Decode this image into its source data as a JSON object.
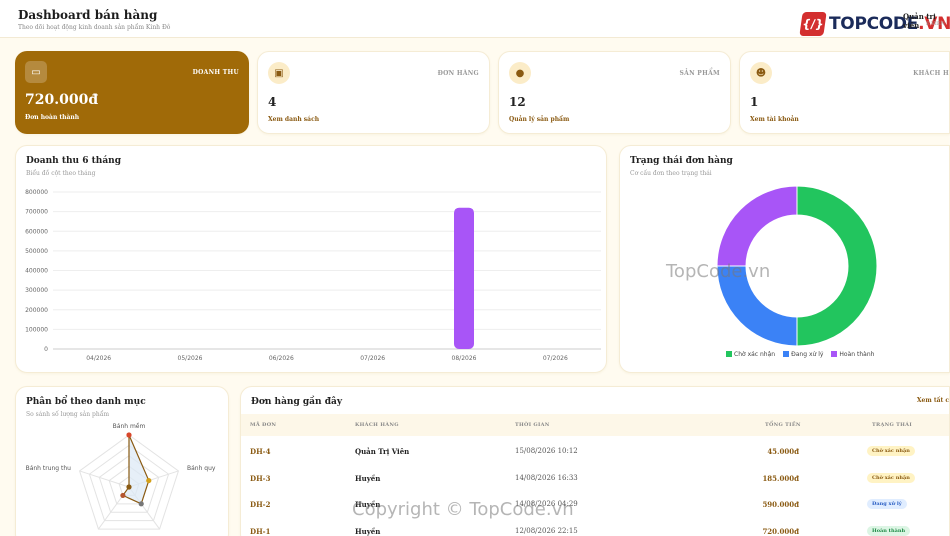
{
  "header": {
    "title": "Dashboard bán hàng",
    "subtitle": "Theo dõi hoạt động kinh doanh sản phẩm Kinh Đô",
    "user_name": "Quản trị viên",
    "user_role": "E VIÊN"
  },
  "logo": {
    "mark": "{/}",
    "text_main": "TOPCODE",
    "text_dot": ".VN"
  },
  "stats": [
    {
      "label": "DOANH THU",
      "value": "720.000đ",
      "link": "Đơn hoàn thành",
      "icon": "wallet-icon",
      "glyph": "▭"
    },
    {
      "label": "ĐƠN HÀNG",
      "value": "4",
      "link": "Xem danh sách",
      "icon": "box-icon",
      "glyph": "▣"
    },
    {
      "label": "SẢN PHẨM",
      "value": "12",
      "link": "Quản lý sản phẩm",
      "icon": "cookie-icon",
      "glyph": "●"
    },
    {
      "label": "KHÁCH H",
      "value": "1",
      "link": "Xem tài khoản",
      "icon": "users-icon",
      "glyph": "☻"
    }
  ],
  "revenue_panel": {
    "title": "Doanh thu 6 tháng",
    "subtitle": "Biểu đồ cột theo tháng"
  },
  "status_panel": {
    "title": "Trạng thái đơn hàng",
    "subtitle": "Cơ cấu đơn theo trạng thái"
  },
  "category_panel": {
    "title": "Phân bổ theo danh mục",
    "subtitle": "So sánh số lượng sản phẩm"
  },
  "orders_panel": {
    "title": "Đơn hàng gần đây",
    "see_all": "Xem tất c",
    "columns": [
      "MÃ ĐƠN",
      "KHÁCH HÀNG",
      "THỜI GIAN",
      "TỔNG TIỀN",
      "TRẠNG THÁI"
    ],
    "rows": [
      {
        "id": "DH-4",
        "customer": "Quản Trị Viên",
        "time": "15/08/2026 10:12",
        "total": "45.000đ",
        "status": "Chờ xác nhận",
        "status_color": "#fff3c4",
        "status_text_color": "#8a5a12"
      },
      {
        "id": "DH-3",
        "customer": "Huyền",
        "time": "14/08/2026 16:33",
        "total": "185.000đ",
        "status": "Chờ xác nhận",
        "status_color": "#fff3c4",
        "status_text_color": "#8a5a12"
      },
      {
        "id": "DH-2",
        "customer": "Huyền",
        "time": "14/08/2026 04:29",
        "total": "590.000đ",
        "status": "Đang xử lý",
        "status_color": "#e0edff",
        "status_text_color": "#2b5fc4"
      },
      {
        "id": "DH-1",
        "customer": "Huyền",
        "time": "12/08/2026 22:15",
        "total": "720.000đ",
        "status": "Hoàn thành",
        "status_color": "#dcf5e4",
        "status_text_color": "#1d8a45"
      }
    ]
  },
  "watermarks": {
    "center": "TopCode.vn",
    "bottom": "Copyright © TopCode.vn"
  },
  "chart_data": [
    {
      "type": "bar",
      "categories": [
        "04/2026",
        "05/2026",
        "06/2026",
        "07/2026",
        "08/2026",
        "07/2026"
      ],
      "values": [
        0,
        0,
        0,
        0,
        720000,
        0
      ],
      "ylim": [
        0,
        800000
      ],
      "yticks": [
        0,
        100000,
        200000,
        300000,
        400000,
        500000,
        600000,
        700000,
        800000
      ],
      "color": "#a855f7",
      "grid": true
    },
    {
      "type": "pie",
      "donut": true,
      "labels": [
        "Chờ xác nhận",
        "Đang xử lý",
        "Hoàn thành"
      ],
      "values": [
        2,
        1,
        1
      ],
      "colors": [
        "#22c55e",
        "#3b82f6",
        "#a855f7"
      ],
      "legend": "bottom"
    },
    {
      "type": "radar",
      "axes": [
        "Bánh mềm",
        "Bánh quy",
        "",
        "",
        "Bánh trung thu"
      ],
      "values": [
        5,
        2,
        2,
        1,
        0
      ],
      "max": 5,
      "color": "#8a5a12",
      "fill": "#dbe8f5"
    }
  ]
}
